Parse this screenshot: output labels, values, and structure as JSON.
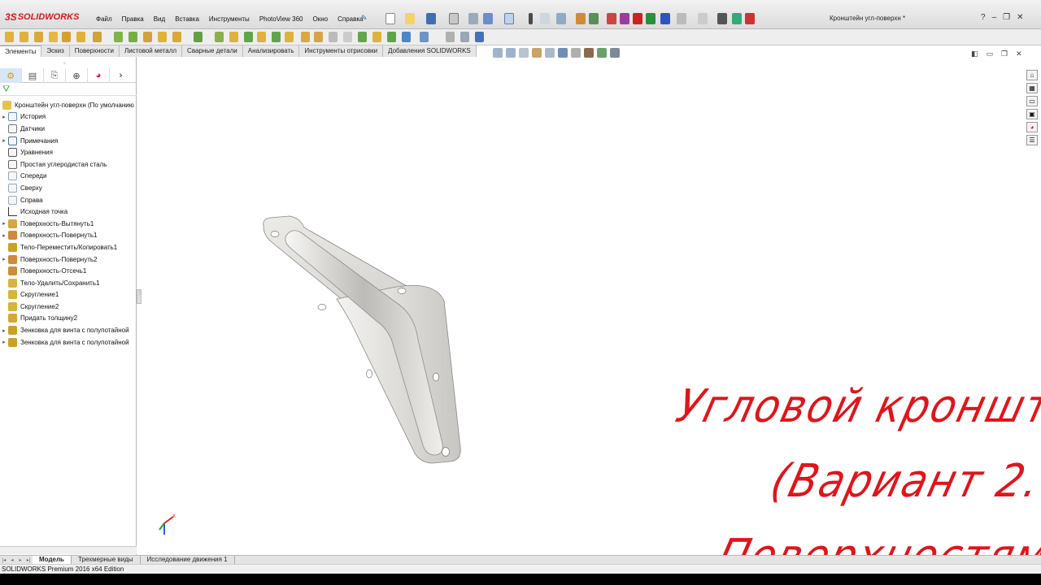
{
  "app": {
    "logo_prefix": "3S",
    "logo_text": "SOLIDWORKS",
    "document_title": "Кронштейн угл-поверхн *"
  },
  "menu": [
    "Файл",
    "Правка",
    "Вид",
    "Вставка",
    "Инструменты",
    "PhotoView 360",
    "Окно",
    "Справка"
  ],
  "title_controls": {
    "help": "?",
    "minimize": "–",
    "restore": "❐",
    "close": "✕"
  },
  "command_tabs": [
    {
      "label": "Элементы",
      "active": true
    },
    {
      "label": "Эскиз"
    },
    {
      "label": "Поверхности"
    },
    {
      "label": "Листовой металл"
    },
    {
      "label": "Сварные детали"
    },
    {
      "label": "Анализировать"
    },
    {
      "label": "Инструменты отрисовки"
    },
    {
      "label": "Добавления SOLIDWORKS"
    }
  ],
  "feature_tree": {
    "root": "Кронштейн угл-поверхн  (По умолчанию",
    "items": [
      {
        "label": "История",
        "icon": "history-icon",
        "expand": "▸"
      },
      {
        "label": "Датчики",
        "icon": "sensor-icon",
        "expand": ""
      },
      {
        "label": "Примечания",
        "icon": "annotation-icon",
        "expand": "▸"
      },
      {
        "label": "Уравнения",
        "icon": "equation-icon",
        "expand": ""
      },
      {
        "label": "Простая углеродистая сталь",
        "icon": "material-icon",
        "expand": ""
      },
      {
        "label": "Спереди",
        "icon": "plane-icon",
        "expand": ""
      },
      {
        "label": "Сверху",
        "icon": "plane-icon",
        "expand": ""
      },
      {
        "label": "Справа",
        "icon": "plane-icon",
        "expand": ""
      },
      {
        "label": "Исходная точка",
        "icon": "origin-icon",
        "expand": ""
      },
      {
        "label": "Поверхность-Вытянуть1",
        "icon": "surface-extrude-icon",
        "expand": "▸"
      },
      {
        "label": "Поверхность-Повернуть1",
        "icon": "surface-revolve-icon",
        "expand": "▸"
      },
      {
        "label": "Тело-Переместить/Копировать1",
        "icon": "move-body-icon",
        "expand": ""
      },
      {
        "label": "Поверхность-Повернуть2",
        "icon": "surface-revolve-icon",
        "expand": "▸"
      },
      {
        "label": "Поверхность-Отсечь1",
        "icon": "surface-trim-icon",
        "expand": ""
      },
      {
        "label": "Тело-Удалить/Сохранить1",
        "icon": "delete-body-icon",
        "expand": ""
      },
      {
        "label": "Скругление1",
        "icon": "fillet-icon",
        "expand": ""
      },
      {
        "label": "Скругление2",
        "icon": "fillet-icon",
        "expand": ""
      },
      {
        "label": "Придать толщину2",
        "icon": "thicken-icon",
        "expand": ""
      },
      {
        "label": "Зенковка для винта с полупотайной",
        "icon": "hole-wizard-icon",
        "expand": "▸"
      },
      {
        "label": "Зенковка для винта с полупотайной",
        "icon": "hole-wizard-icon",
        "expand": "▸"
      }
    ]
  },
  "overlay_text": [
    "Угловой кронштейн",
    "(Вариант 2.",
    "Поверхностями)"
  ],
  "triad": {
    "x_label": "X"
  },
  "bottom_tabs": [
    {
      "label": "Модель",
      "active": true
    },
    {
      "label": "Трехмерные виды"
    },
    {
      "label": "Исследование движения 1"
    }
  ],
  "status_bar": "SOLIDWORKS Premium 2016 x64 Edition",
  "colors": {
    "brand_red": "#d71920",
    "overlay_red": "#e0151b",
    "part_gray": "#d9d8d4"
  }
}
